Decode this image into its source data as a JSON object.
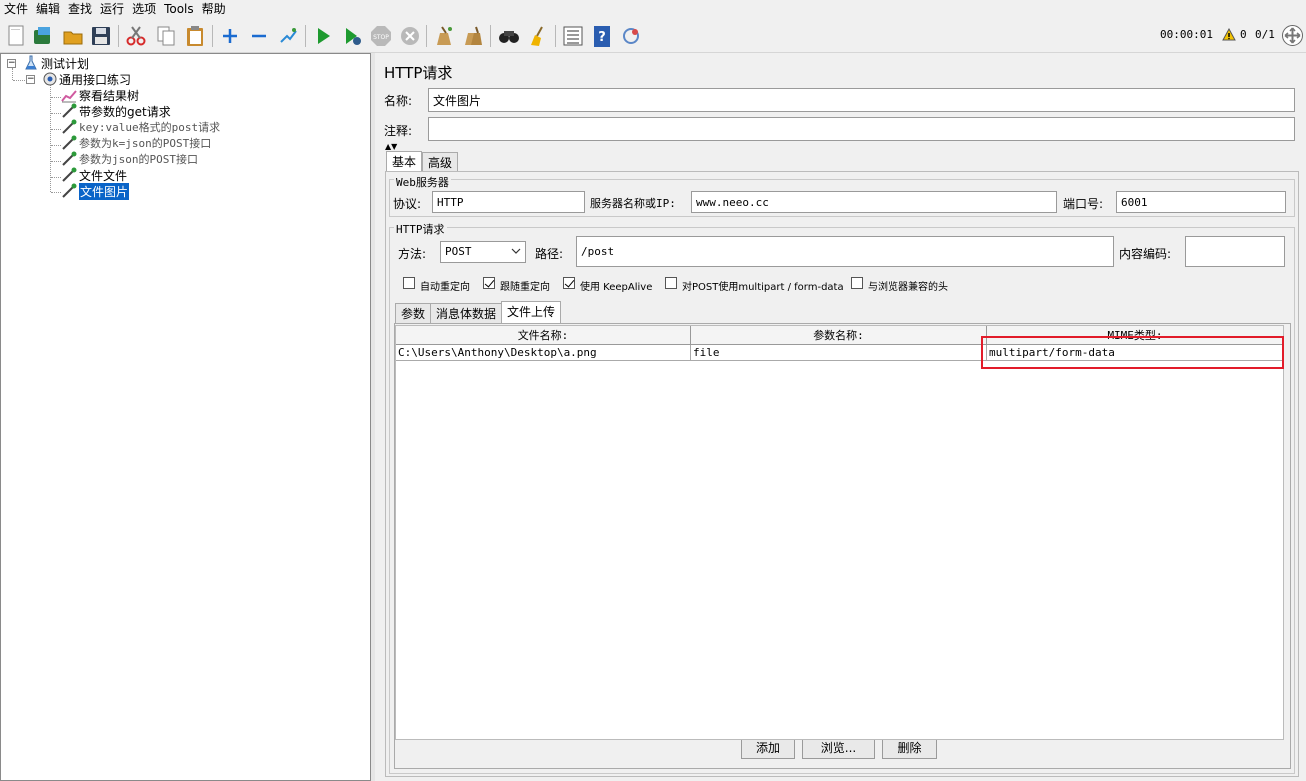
{
  "menu": [
    "文件",
    "编辑",
    "查找",
    "运行",
    "选项",
    "Tools",
    "帮助"
  ],
  "toolbar": {
    "icons": [
      "new-icon",
      "templates-icon",
      "open-icon",
      "save-icon",
      "cut-icon",
      "copy-icon",
      "paste-icon",
      "expand-icon",
      "collapse-icon",
      "toggle-icon",
      "start-icon",
      "start-no-pause-icon",
      "stop-icon",
      "shutdown-icon",
      "clear-icon",
      "clear-all-icon",
      "search-icon",
      "reset-search-icon",
      "function-helper-icon",
      "help-icon",
      "remote-icon"
    ],
    "timer": "00:00:01",
    "warn_count": "0",
    "threads": "0/1"
  },
  "tree": {
    "root": "测试计划",
    "group": "通用接口练习",
    "items": [
      {
        "label": "察看结果树",
        "mono": false
      },
      {
        "label": "带参数的get请求",
        "mono": false
      },
      {
        "label": "key:value格式的post请求",
        "mono": true
      },
      {
        "label": "参数为k=json的POST接口",
        "mono": true
      },
      {
        "label": "参数为json的POST接口",
        "mono": true
      },
      {
        "label": "文件文件",
        "mono": false
      },
      {
        "label": "文件图片",
        "mono": false,
        "selected": true
      }
    ]
  },
  "panel": {
    "title": "HTTP请求",
    "name_label": "名称:",
    "name_value": "文件图片",
    "comment_label": "注释:",
    "comment_value": "",
    "tabs": [
      "基本",
      "高级"
    ],
    "web_server": {
      "legend": "Web服务器",
      "protocol_label": "协议:",
      "protocol_value": "HTTP",
      "server_label": "服务器名称或IP:",
      "server_value": "www.neeo.cc",
      "port_label": "端口号:",
      "port_value": "6001"
    },
    "http_request": {
      "legend": "HTTP请求",
      "method_label": "方法:",
      "method_value": "POST",
      "path_label": "路径:",
      "path_value": "/post",
      "encoding_label": "内容编码:",
      "encoding_value": ""
    },
    "options": [
      {
        "label": "自动重定向",
        "checked": false
      },
      {
        "label": "跟随重定向",
        "checked": true
      },
      {
        "label": "使用 KeepAlive",
        "checked": true
      },
      {
        "label": "对POST使用multipart / form-data",
        "checked": false
      },
      {
        "label": "与浏览器兼容的头",
        "checked": false
      }
    ],
    "sub_tabs": [
      "参数",
      "消息体数据",
      "文件上传"
    ],
    "file_table": {
      "headers": [
        "文件名称:",
        "参数名称:",
        "MIME类型:"
      ],
      "rows": [
        [
          "C:\\Users\\Anthony\\Desktop\\a.png",
          "file",
          "multipart/form-data"
        ]
      ]
    },
    "buttons": {
      "add": "添加",
      "browse": "浏览...",
      "delete": "删除"
    }
  }
}
